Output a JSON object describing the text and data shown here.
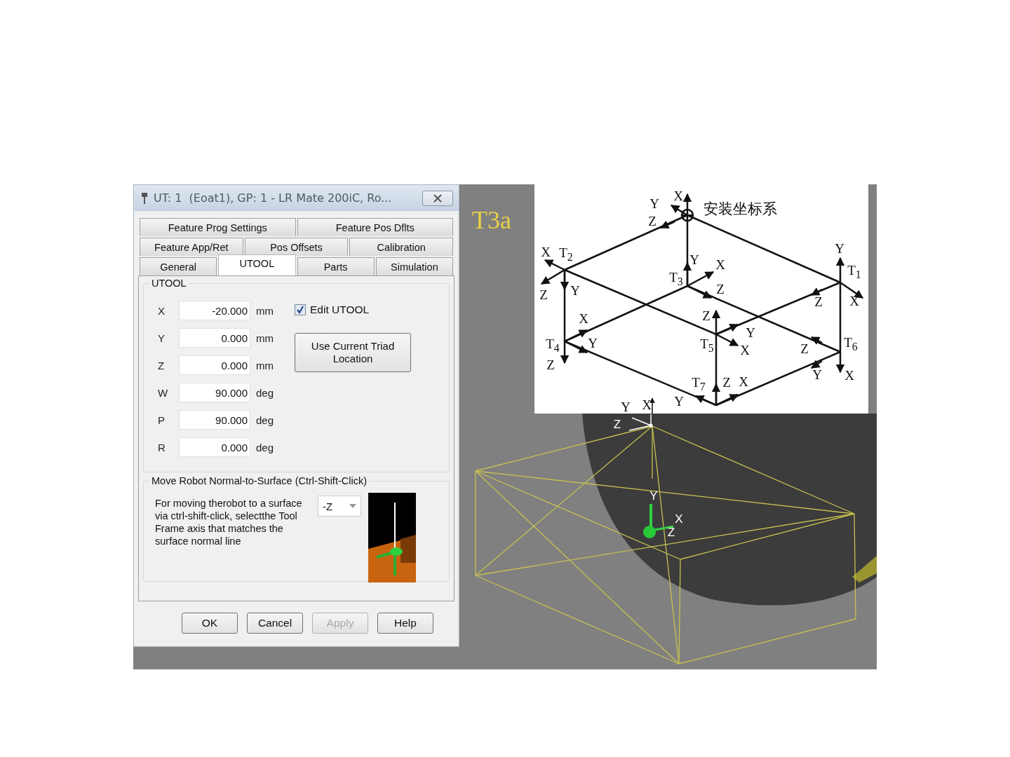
{
  "window": {
    "title": "UT: 1  (Eoat1), GP: 1 - LR Mate 200iC, Ro..."
  },
  "tab_rows": [
    [
      {
        "label": "Feature Prog Settings",
        "selected": false
      },
      {
        "label": "Feature Pos Dflts",
        "selected": false
      }
    ],
    [
      {
        "label": "Feature App/Ret",
        "selected": false
      },
      {
        "label": "Pos Offsets",
        "selected": false
      },
      {
        "label": "Calibration",
        "selected": false
      }
    ],
    [
      {
        "label": "General",
        "selected": false
      },
      {
        "label": "UTOOL",
        "selected": true
      },
      {
        "label": "Parts",
        "selected": false
      },
      {
        "label": "Simulation",
        "selected": false
      }
    ]
  ],
  "utool_group": {
    "title": "UTOOL",
    "fields": [
      {
        "label": "X",
        "value": "-20.000",
        "unit": "mm"
      },
      {
        "label": "Y",
        "value": "0.000",
        "unit": "mm"
      },
      {
        "label": "Z",
        "value": "0.000",
        "unit": "mm"
      },
      {
        "label": "W",
        "value": "90.000",
        "unit": "deg"
      },
      {
        "label": "P",
        "value": "90.000",
        "unit": "deg"
      },
      {
        "label": "R",
        "value": "0.000",
        "unit": "deg"
      }
    ],
    "edit_checkbox": {
      "label": "Edit UTOOL",
      "checked": true
    },
    "triad_button": "Use Current Triad Location"
  },
  "normal_group": {
    "title": "Move Robot Normal-to-Surface (Ctrl-Shift-Click)",
    "description": "For moving therobot to a surface via ctrl-shift-click, selectthe Tool Frame axis that matches the surface normal line",
    "axis_dropdown": {
      "value": "-Z"
    }
  },
  "buttons": [
    {
      "label": "OK",
      "disabled": false
    },
    {
      "label": "Cancel",
      "disabled": false
    },
    {
      "label": "Apply",
      "disabled": true
    },
    {
      "label": "Help",
      "disabled": false
    }
  ],
  "viewport": {
    "title_label": "T3a",
    "diagram_labels": [
      "X",
      "Y",
      "安装坐标系",
      "Z",
      "X",
      "T$_{2}$",
      "Y",
      "Y",
      "X",
      "T$_{3}$",
      "T$_{1}$",
      "Z",
      "Y",
      "Z",
      "Z",
      "X",
      "X",
      "Z",
      "Y",
      "T$_{4}$",
      "Y",
      "T$_{5}$",
      "X",
      "Z",
      "T$_{6}$",
      "Z",
      "Y",
      "X",
      "T$_{7}$",
      "Z",
      "X",
      "Y",
      "Y",
      "X"
    ],
    "triad_labels": [
      "Z",
      "Y",
      "X",
      "Z"
    ]
  }
}
